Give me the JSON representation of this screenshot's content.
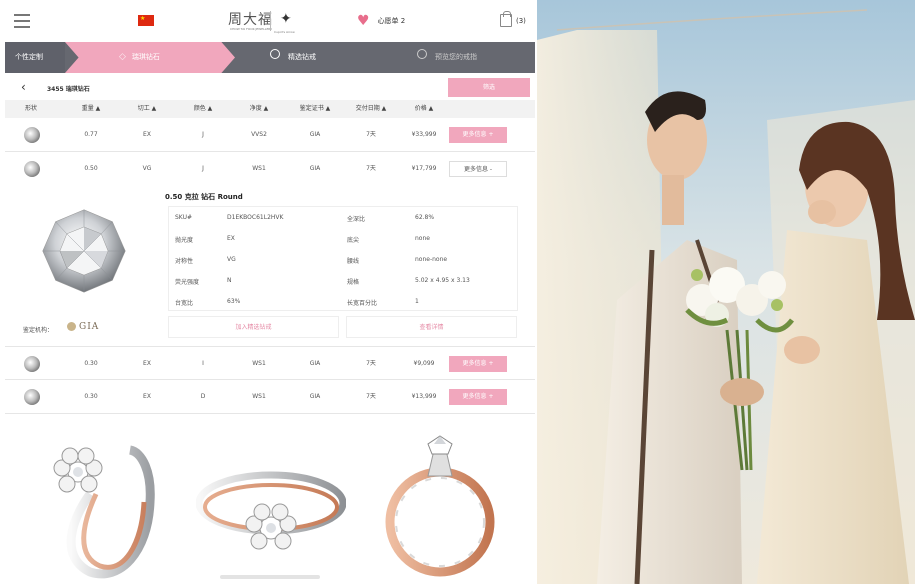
{
  "header": {
    "menu_icon": "menu-icon",
    "brand_cn": "周大福",
    "brand_en": "CHOW TAI FOOK JEWELLERY",
    "sub_brand": "Cupid's Arrow",
    "wishlist_label": "心愿单 2",
    "cart_count": "(3)"
  },
  "steps": {
    "step1": "个性定制",
    "step2": "瑞琪钻石",
    "step3": "精选钻戒",
    "step4": "预览您的戒指"
  },
  "results": {
    "count_label": "3455 瑞琪钻石",
    "filter_label": "筛选"
  },
  "table": {
    "headers": [
      "形状",
      "重量 ▲",
      "切工 ▲",
      "颜色 ▲",
      "净度 ▲",
      "鉴定证书 ▲",
      "交付日期 ▲",
      "价格 ▲"
    ],
    "rows": [
      {
        "weight": "0.77",
        "cut": "EX",
        "color": "J",
        "clarity": "VVS2",
        "cert": "GIA",
        "delivery": "7天",
        "price": "¥33,999",
        "action": "更多信息 +"
      },
      {
        "weight": "0.50",
        "cut": "VG",
        "color": "J",
        "clarity": "WS1",
        "cert": "GIA",
        "delivery": "7天",
        "price": "¥17,799",
        "action": "更多信息 -"
      },
      {
        "weight": "0.30",
        "cut": "EX",
        "color": "I",
        "clarity": "WS1",
        "cert": "GIA",
        "delivery": "7天",
        "price": "¥9,099",
        "action": "更多信息 +"
      },
      {
        "weight": "0.30",
        "cut": "EX",
        "color": "D",
        "clarity": "WS1",
        "cert": "GIA",
        "delivery": "7天",
        "price": "¥13,999",
        "action": "更多信息 +"
      }
    ]
  },
  "detail": {
    "title": "0.50 克拉 钻石 Round",
    "specs_left": [
      {
        "label": "SKU#",
        "value": "D1EKBOC61L2HVK"
      },
      {
        "label": "抛光度",
        "value": "EX"
      },
      {
        "label": "对称性",
        "value": "VG"
      },
      {
        "label": "荧光强度",
        "value": "N"
      },
      {
        "label": "台宽比",
        "value": "63%"
      }
    ],
    "specs_right": [
      {
        "label": "全深比",
        "value": "62.8%"
      },
      {
        "label": "底尖",
        "value": "none"
      },
      {
        "label": "腰线",
        "value": "none-none"
      },
      {
        "label": "规格",
        "value": "5.02 x 4.95 x 3.13"
      },
      {
        "label": "长宽百分比",
        "value": "1"
      }
    ],
    "add_button": "加入精选钻戒",
    "view_button": "查看详情",
    "cert_label": "鉴定机构：",
    "cert_logo": "GIA"
  },
  "colors": {
    "accent_pink": "#f1a7bd",
    "steps_bar": "#666870",
    "heart": "#e86e8c",
    "flag_red": "#de2910"
  }
}
